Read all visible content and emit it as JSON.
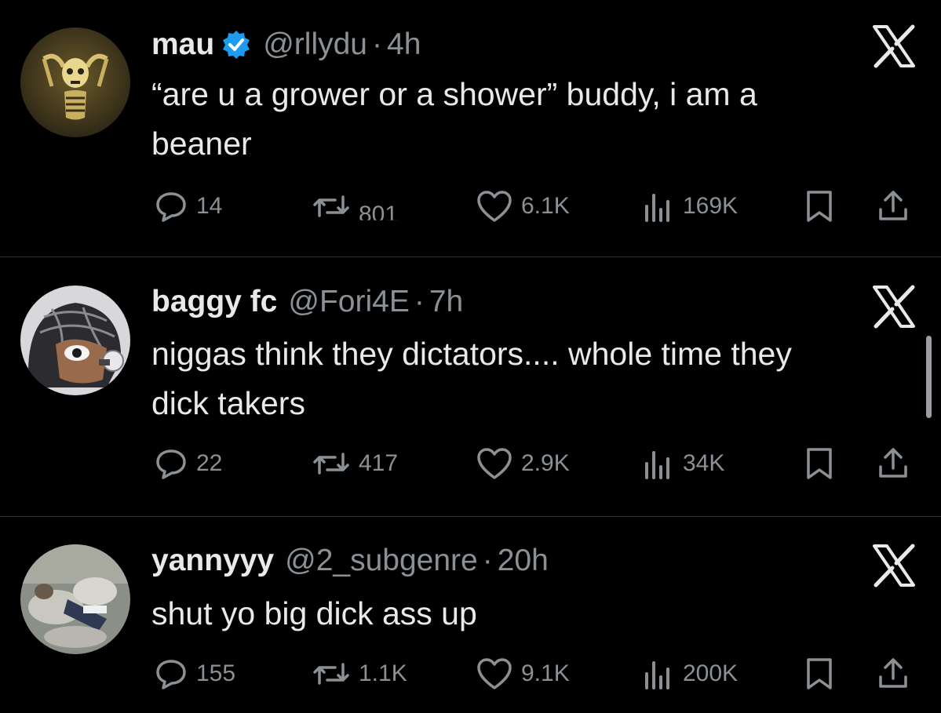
{
  "theme": {
    "background": "#000000",
    "text_primary": "#e7e9ea",
    "text_secondary": "#8b9095",
    "verified_color": "#1d9bf0",
    "divider": "#2f3336"
  },
  "posts": [
    {
      "name": "mau",
      "verified": true,
      "handle": "@rllydu",
      "separator": "·",
      "time": "4h",
      "text_lines": [
        "“are u a grower or a shower” buddy, i am a",
        "beaner"
      ],
      "avatar": "skeleton-avatar",
      "replies": "14",
      "reposts": "801",
      "likes": "6.1K",
      "views": "169K"
    },
    {
      "name": "baggy fc",
      "verified": false,
      "handle": "@Fori4E",
      "separator": "·",
      "time": "7h",
      "text_lines": [
        "niggas think they dictators.... whole time they",
        "dick takers"
      ],
      "avatar": "cartoon-avatar",
      "replies": "22",
      "reposts": "417",
      "likes": "2.9K",
      "views": "34K"
    },
    {
      "name": "yannyyy",
      "verified": false,
      "handle": "@2_subgenre",
      "separator": "·",
      "time": "20h",
      "text_lines": [
        "shut yo big dick ass up"
      ],
      "avatar": "photo-avatar",
      "replies": "155",
      "reposts": "1.1K",
      "likes": "9.1K",
      "views": "200K"
    }
  ],
  "icons": {
    "reply": "reply-icon",
    "repost": "repost-icon",
    "like": "like-icon",
    "views": "views-icon",
    "bookmark": "bookmark-icon",
    "share": "share-icon",
    "close": "x-logo-icon",
    "verified": "verified-badge-icon"
  }
}
